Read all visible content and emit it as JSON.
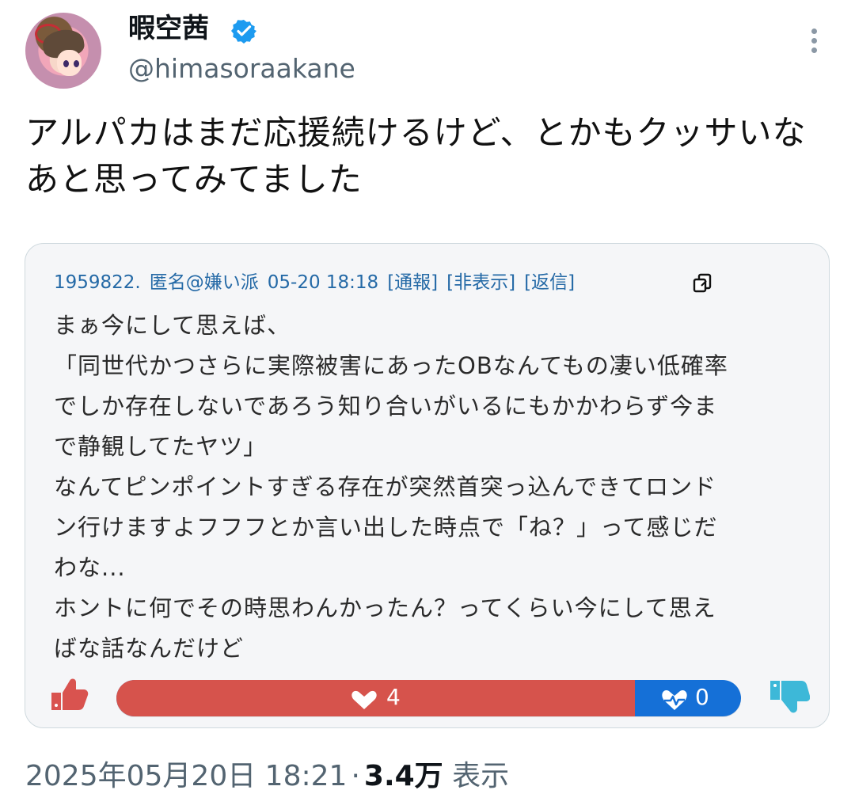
{
  "profile": {
    "display_name": "暇空茜",
    "handle": "@himasoraakane"
  },
  "tweet": {
    "text": "アルパカはまだ応援続けるけど、とかもクッサいなあと思ってみてました"
  },
  "quote": {
    "post_number": "1959822.",
    "name": "匿名@嫌い派",
    "timestamp": "05-20 18:18",
    "actions": [
      "[通報]",
      "[非表示]",
      "[返信]"
    ],
    "body_lines": [
      "まぁ今にして思えば、",
      "「同世代かつさらに実際被害にあったOBなんてもの凄い低確率",
      "でしか存在しないであろう知り合いがいるにもかかわらず今ま",
      "で静観してたヤツ」",
      "なんてピンポイントすぎる存在が突然首突っ込んできてロンド",
      "ン行けますよフフフとか言い出した時点で「ね？」って感じだ",
      "わな...",
      "ホントに何でその時思わんかったん？ってくらい今にして思え",
      "ばな話なんだけど"
    ],
    "likes": "4",
    "dislikes": "0"
  },
  "footer": {
    "timestamp": "2025年05月20日 18:21",
    "views": "3.4万",
    "views_label": "表示"
  },
  "colors": {
    "accent_blue": "#1d9bf0",
    "meta_blue": "#2469a6",
    "vote_red": "#d6534c",
    "vote_blue": "#1570d7",
    "thumb_red": "#d9534f",
    "thumb_blue": "#3db8d8"
  },
  "icons": [
    "verified-icon",
    "more-icon",
    "copy-icon",
    "thumbs-up-icon",
    "heart-icon",
    "heartbeat-icon",
    "thumbs-down-icon"
  ]
}
